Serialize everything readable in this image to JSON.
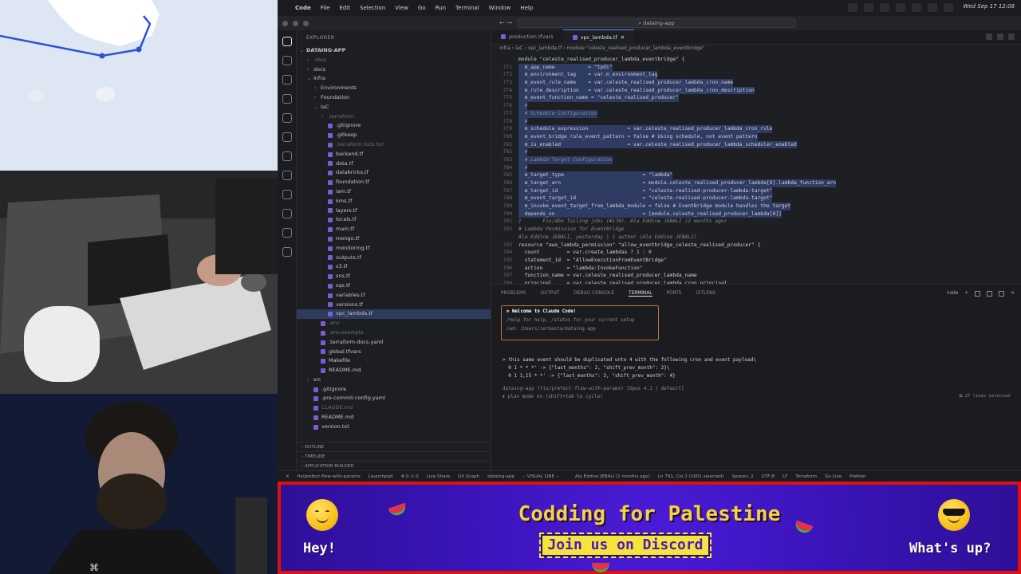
{
  "menubar": {
    "app": "Code",
    "items": [
      "File",
      "Edit",
      "Selection",
      "View",
      "Go",
      "Run",
      "Terminal",
      "Window",
      "Help"
    ],
    "datetime": "Wed Sep 17 12:08"
  },
  "title": {
    "search": "dataing-app"
  },
  "explorer": {
    "header": "EXPLORER",
    "root": "DATAING-APP",
    "items": [
      {
        "label": ".idea",
        "kind": "folder",
        "depth": 1,
        "chev": "›",
        "dim": true
      },
      {
        "label": "docs",
        "kind": "folder",
        "depth": 1,
        "chev": "›"
      },
      {
        "label": "infra",
        "kind": "folder",
        "depth": 1,
        "chev": "⌄"
      },
      {
        "label": "Environments",
        "kind": "folder",
        "depth": 2,
        "chev": "›"
      },
      {
        "label": "Foundation",
        "kind": "folder",
        "depth": 2,
        "chev": "›"
      },
      {
        "label": "IaC",
        "kind": "folder",
        "depth": 2,
        "chev": "⌄"
      },
      {
        "label": ".terraform",
        "kind": "folder",
        "depth": 3,
        "chev": "›",
        "dim": true
      },
      {
        "label": ".gitignore",
        "kind": "file",
        "depth": 3
      },
      {
        "label": ".gitkeep",
        "kind": "file",
        "depth": 3
      },
      {
        "label": ".terraform.lock.hcl",
        "kind": "file",
        "depth": 3,
        "dim": true
      },
      {
        "label": "backend.tf",
        "kind": "file",
        "depth": 3
      },
      {
        "label": "data.tf",
        "kind": "file",
        "depth": 3
      },
      {
        "label": "databricks.tf",
        "kind": "file",
        "depth": 3
      },
      {
        "label": "foundation.tf",
        "kind": "file",
        "depth": 3
      },
      {
        "label": "iam.tf",
        "kind": "file",
        "depth": 3
      },
      {
        "label": "kms.tf",
        "kind": "file",
        "depth": 3
      },
      {
        "label": "layers.tf",
        "kind": "file",
        "depth": 3
      },
      {
        "label": "locals.tf",
        "kind": "file",
        "depth": 3
      },
      {
        "label": "main.tf",
        "kind": "file",
        "depth": 3
      },
      {
        "label": "mongo.tf",
        "kind": "file",
        "depth": 3
      },
      {
        "label": "monitoring.tf",
        "kind": "file",
        "depth": 3
      },
      {
        "label": "outputs.tf",
        "kind": "file",
        "depth": 3
      },
      {
        "label": "s3.tf",
        "kind": "file",
        "depth": 3
      },
      {
        "label": "sns.tf",
        "kind": "file",
        "depth": 3
      },
      {
        "label": "sqs.tf",
        "kind": "file",
        "depth": 3
      },
      {
        "label": "variables.tf",
        "kind": "file",
        "depth": 3
      },
      {
        "label": "versions.tf",
        "kind": "file",
        "depth": 3
      },
      {
        "label": "vpc_lambda.tf",
        "kind": "file",
        "depth": 3,
        "selected": true
      },
      {
        "label": ".env",
        "kind": "file",
        "depth": 2,
        "dim": true
      },
      {
        "label": ".env.example",
        "kind": "file",
        "depth": 2,
        "dim": true
      },
      {
        "label": ".terraform-docs.yaml",
        "kind": "file",
        "depth": 2
      },
      {
        "label": "global.tfvars",
        "kind": "file",
        "depth": 2
      },
      {
        "label": "Makefile",
        "kind": "file",
        "depth": 2
      },
      {
        "label": "README.md",
        "kind": "file",
        "depth": 2
      },
      {
        "label": "src",
        "kind": "folder",
        "depth": 1,
        "chev": "›"
      },
      {
        "label": ".gitignore",
        "kind": "file",
        "depth": 1
      },
      {
        "label": ".pre-commit-config.yaml",
        "kind": "file",
        "depth": 1
      },
      {
        "label": "CLAUDE.md",
        "kind": "file",
        "depth": 1,
        "dim": true
      },
      {
        "label": "README.md",
        "kind": "file",
        "depth": 1
      },
      {
        "label": "version.txt",
        "kind": "file",
        "depth": 1
      }
    ],
    "sections": [
      "OUTLINE",
      "TIMELINE",
      "APPLICATION BUILDER"
    ]
  },
  "tabs": [
    {
      "label": "production.tfvars",
      "active": false
    },
    {
      "label": "vpc_lambda.tf",
      "active": true
    }
  ],
  "breadcrumb": "infra › IaC › vpc_lambda.tf › module \"celeste_realised_producer_lambda_eventbridge\"",
  "code": [
    {
      "n": "",
      "t": "module \"celeste_realised_producer_lambda_eventbridge\" {",
      "hl": false
    },
    {
      "n": "771",
      "t": "  m_app_name           = \"tpdi\"",
      "hl": true
    },
    {
      "n": "772",
      "t": "  m_environment_tag    = var.m_environment_tag",
      "hl": true
    },
    {
      "n": "773",
      "t": "  m_event_rule_name    = var.celeste_realised_producer_lambda_cron_name",
      "hl": true
    },
    {
      "n": "774",
      "t": "  m_rule_description   = var.celeste_realised_producer_lambda_cron_description",
      "hl": true
    },
    {
      "n": "775",
      "t": "  m_event_function_name = \"celeste_realised_producer\"",
      "hl": true
    },
    {
      "n": "776",
      "t": "  #",
      "hl": true
    },
    {
      "n": "777",
      "t": "  # Schedule Configuration",
      "hl": true
    },
    {
      "n": "778",
      "t": "  #",
      "hl": true
    },
    {
      "n": "779",
      "t": "  m_schedule_expression             = var.celeste_realised_producer_lambda_cron_rule",
      "hl": true
    },
    {
      "n": "780",
      "t": "  m_event_bridge_rule_event_pattern = false # Using schedule, not event pattern",
      "hl": true
    },
    {
      "n": "781",
      "t": "  m_is_enabled                      = var.celeste_realised_producer_lambda_scheduler_enabled",
      "hl": true
    },
    {
      "n": "782",
      "t": "  #",
      "hl": true
    },
    {
      "n": "783",
      "t": "  # Lambda Target Configuration",
      "hl": true
    },
    {
      "n": "784",
      "t": "  #",
      "hl": true
    },
    {
      "n": "785",
      "t": "  m_target_type                          = \"lambda\"",
      "hl": true
    },
    {
      "n": "786",
      "t": "  m_target_arn                           = module.celeste_realised_producer_lambda[0].lambda_function_arn",
      "hl": true
    },
    {
      "n": "787",
      "t": "  m_target_id                            = \"celeste-realised-producer-lambda-target\"",
      "hl": true
    },
    {
      "n": "788",
      "t": "  m_event_target_id                      = \"celeste-realised-producer-lambda-target\"",
      "hl": true
    },
    {
      "n": "789",
      "t": "  m_invoke_event_target_from_lambda_module = false # EventBridge module handles the target",
      "hl": true
    },
    {
      "n": "790",
      "t": "  depends_on                             = [module.celeste_realised_producer_lambda[0]]",
      "hl": true
    },
    {
      "n": "791",
      "t": "}       Fix/dbx failing jobs (#179), Ala Eddine JEBALI (2 months ago)",
      "hl": false
    },
    {
      "n": "792",
      "t": "# Lambda Permission for EventBridge",
      "hl": false
    },
    {
      "n": "",
      "t": "Ala Eddine JEBALI, yesterday | 1 author (Ala Eddine JEBALI)",
      "hl": false
    },
    {
      "n": "793",
      "t": "resource \"aws_lambda_permission\" \"allow_eventbridge_celeste_realised_producer\" {",
      "hl": false
    },
    {
      "n": "794",
      "t": "  count         = var.create_lambdas ? 1 : 0",
      "hl": false
    },
    {
      "n": "795",
      "t": "  statement_id  = \"AllowExecutionFromEventBridge\"",
      "hl": false
    },
    {
      "n": "796",
      "t": "  action        = \"lambda:InvokeFunction\"",
      "hl": false
    },
    {
      "n": "797",
      "t": "  function_name = var.celeste_realised_producer_lambda_name",
      "hl": false
    },
    {
      "n": "798",
      "t": "  principal     = var.celeste_realised_producer_lambda_cron_principal",
      "hl": false
    }
  ],
  "panel": {
    "tabs": [
      "PROBLEMS",
      "OUTPUT",
      "DEBUG CONSOLE",
      "TERMINAL",
      "PORTS",
      "GITLENS"
    ],
    "active_tab": "TERMINAL",
    "shell": "node",
    "welcome": {
      "title": "Welcome to Claude Code!",
      "help": "/help for help, /status for your current setup",
      "cwd": "cwd: /Users/zerbasta/dataing-app"
    },
    "lines": [
      "> this same event should be duplicated unto 4 with the following cron and event payload\\",
      "  0 1 * * *' -> {\"last_months\": 2, \"shift_prev_month\": 2}\\",
      "  0 1 1,15 * *' -> {\"last_months\": 3, \"shift_prev_month\": 4}"
    ],
    "prompt": "dataing-app (fix/prefect-flow-with-params) [Opus 4.1 | default]",
    "mode": "⏵ plan mode on (shift+tab to cycle)",
    "selection": "⧉ 27 lines selected"
  },
  "status": [
    "✕",
    "fix/prefect-flow-with-params",
    "Launchpad",
    "⊗ 0  ⚠ 0",
    "Live Share",
    "Git Graph",
    "dataing-app",
    "-- VISUAL LINE --",
    "Ala Eddine JEBALI (2 months ago)",
    "Ln 791, Col 2 (1601 selected)",
    "Spaces: 2",
    "UTF-8",
    "LF",
    "Terraform",
    "Go Live",
    "Prettier"
  ],
  "banner": {
    "title": "Codding for Palestine",
    "cta": "Join us on Discord",
    "left": "Hey!",
    "right": "What's up?"
  }
}
